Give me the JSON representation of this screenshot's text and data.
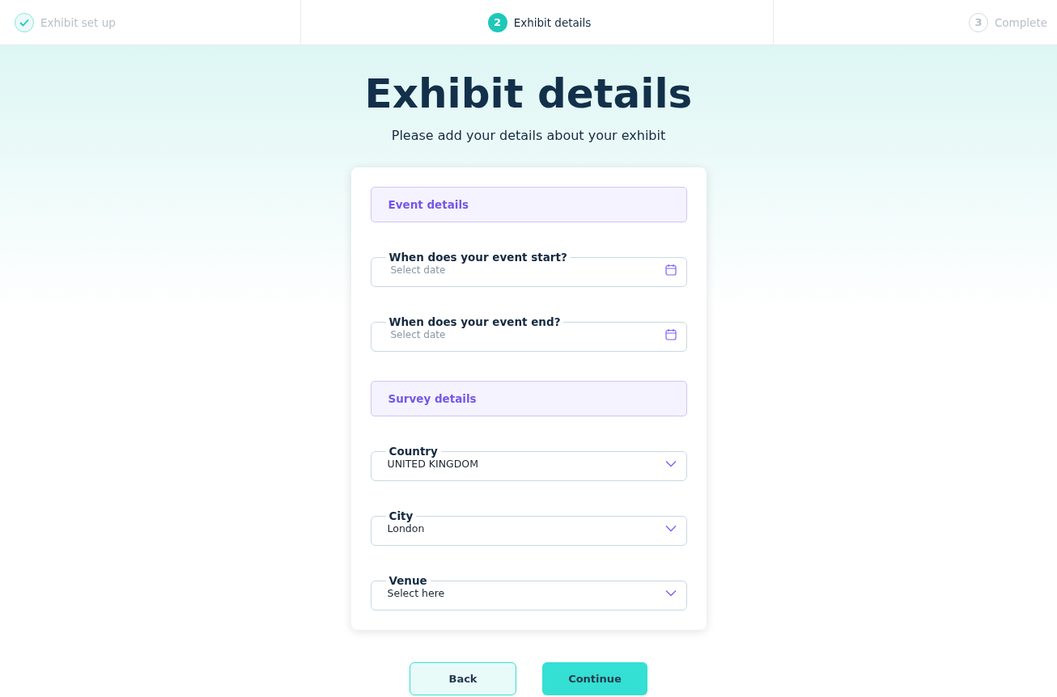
{
  "steps": [
    {
      "label": "Exhibit set up",
      "completed": true,
      "selected": false
    },
    {
      "number": "2",
      "label": "Exhibit details",
      "completed": false,
      "selected": true
    },
    {
      "number": "3",
      "label": "Complete",
      "completed": false,
      "selected": false
    }
  ],
  "heading": "Exhibit details",
  "subheading": "Please add your details about your exhibit",
  "sections": [
    {
      "title": "Event details",
      "fields": [
        {
          "kind": "date",
          "label": "When does your event start?",
          "placeholder": "Select date"
        },
        {
          "kind": "date",
          "label": "When does your event end?",
          "placeholder": "Select date"
        }
      ]
    },
    {
      "title": "Survey details",
      "fields": [
        {
          "kind": "select",
          "label": "Country",
          "value": "UNITED KINGDOM"
        },
        {
          "kind": "select",
          "label": "City",
          "value": "London"
        },
        {
          "kind": "select",
          "label": "Venue",
          "value": "Select here"
        }
      ]
    }
  ],
  "buttons": [
    {
      "label": "Back",
      "kind": "secondary"
    },
    {
      "label": "Continue",
      "kind": "primary"
    }
  ]
}
